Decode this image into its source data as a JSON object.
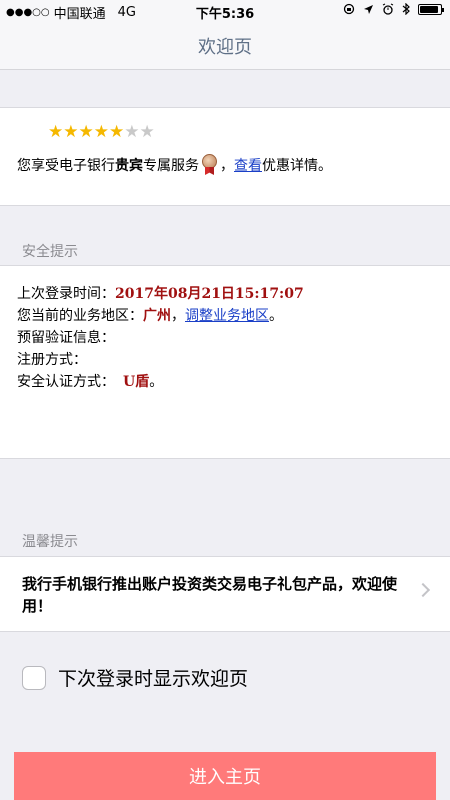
{
  "status_bar": {
    "signal": "●●●○○",
    "carrier": "中国联通",
    "network": "4G",
    "time": "下午5:36",
    "icons": [
      "orientation-lock-icon",
      "location-icon",
      "alarm-icon",
      "bluetooth-icon",
      "battery-icon"
    ],
    "battery_level": 0.9
  },
  "nav": {
    "title": "欢迎页"
  },
  "vip": {
    "stars_filled": 5,
    "stars_total": 7,
    "text_before": "您享受电子银行",
    "text_bold": "贵宾",
    "text_after": "专属服务",
    "comma": "，",
    "link_label": "查看",
    "text_end": "优惠详情。"
  },
  "security": {
    "section_title": "安全提示",
    "last_login_label": "上次登录时间：",
    "last_login_value": "2017年08月21日15:17:07",
    "region_label": "您当前的业务地区：",
    "region_value": "广州",
    "region_sep": "，",
    "region_link": "调整业务地区",
    "region_end": "。",
    "verify_label": "预留验证信息：",
    "register_label": "注册方式：",
    "auth_label": "安全认证方式：",
    "auth_value": "U盾",
    "auth_end": "。"
  },
  "tips": {
    "section_title": "温馨提示",
    "message": "我行手机银行推出账户投资类交易电子礼包产品，欢迎使用！"
  },
  "checkbox": {
    "label": "下次登录时显示欢迎页",
    "checked": false
  },
  "enter_button": {
    "label": "进入主页"
  },
  "colors": {
    "accent_button": "#ff7a7a",
    "link": "#1a3fc7",
    "highlight_value": "#a01010",
    "nav_title": "#5e6f86",
    "star_on": "#f5b800"
  }
}
